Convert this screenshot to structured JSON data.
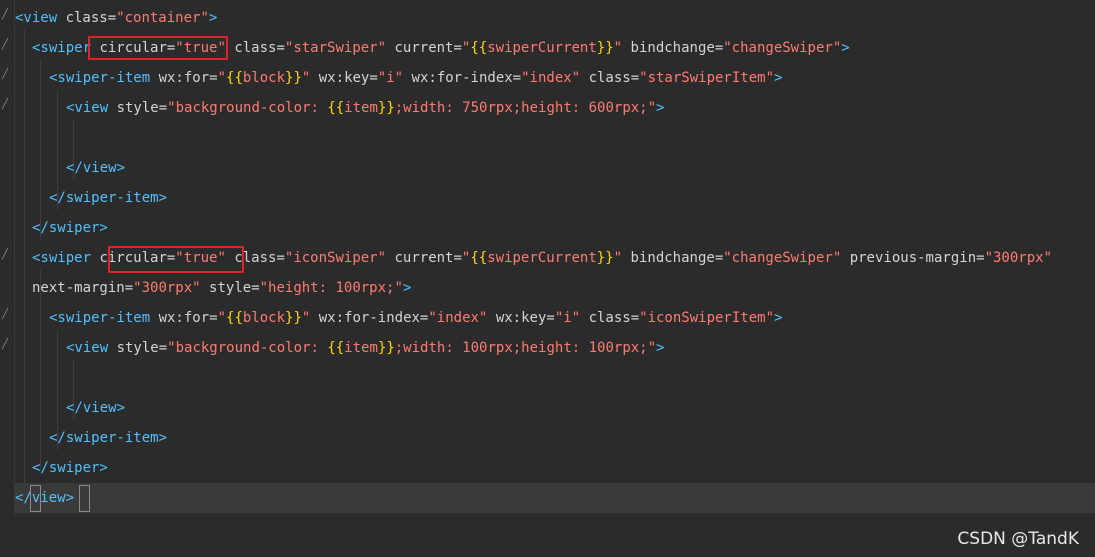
{
  "lines": [
    {
      "indent": 0,
      "tokens": [
        [
          "tag",
          "<view "
        ],
        [
          "attr",
          "class="
        ],
        [
          "str",
          "\"container\""
        ],
        [
          "tag",
          ">"
        ]
      ]
    },
    {
      "indent": 1,
      "tokens": [
        [
          "tag",
          "<swiper "
        ],
        [
          "attr",
          "circular="
        ],
        [
          "str",
          "\"true\""
        ],
        [
          "plain",
          " "
        ],
        [
          "attr",
          "class="
        ],
        [
          "str",
          "\"starSwiper\""
        ],
        [
          "plain",
          " "
        ],
        [
          "attr",
          "current="
        ],
        [
          "str",
          "\""
        ],
        [
          "brace",
          "{{"
        ],
        [
          "str",
          "swiperCurrent"
        ],
        [
          "brace",
          "}}"
        ],
        [
          "str",
          "\""
        ],
        [
          "plain",
          " "
        ],
        [
          "attr",
          "bindchange="
        ],
        [
          "str",
          "\"changeSwiper\""
        ],
        [
          "tag",
          ">"
        ]
      ]
    },
    {
      "indent": 2,
      "tokens": [
        [
          "tag",
          "<swiper-item "
        ],
        [
          "attr",
          "wx:for="
        ],
        [
          "str",
          "\""
        ],
        [
          "brace",
          "{{"
        ],
        [
          "str",
          "block"
        ],
        [
          "brace",
          "}}"
        ],
        [
          "str",
          "\""
        ],
        [
          "plain",
          " "
        ],
        [
          "attr",
          "wx:key="
        ],
        [
          "str",
          "\"i\""
        ],
        [
          "plain",
          " "
        ],
        [
          "attr",
          "wx:for-index="
        ],
        [
          "str",
          "\"index\""
        ],
        [
          "plain",
          " "
        ],
        [
          "attr",
          "class="
        ],
        [
          "str",
          "\"starSwiperItem\""
        ],
        [
          "tag",
          ">"
        ]
      ]
    },
    {
      "indent": 3,
      "tokens": [
        [
          "tag",
          "<view "
        ],
        [
          "attr",
          "style="
        ],
        [
          "str",
          "\"background-color: "
        ],
        [
          "brace",
          "{{"
        ],
        [
          "str",
          "item"
        ],
        [
          "brace",
          "}}"
        ],
        [
          "str",
          ";width: 750rpx;height: 600rpx;\""
        ],
        [
          "tag",
          ">"
        ]
      ]
    },
    {
      "indent": 3,
      "tokens": []
    },
    {
      "indent": 3,
      "tokens": [
        [
          "tag",
          "</view>"
        ]
      ]
    },
    {
      "indent": 2,
      "tokens": [
        [
          "tag",
          "</swiper-item>"
        ]
      ]
    },
    {
      "indent": 1,
      "tokens": [
        [
          "tag",
          "</swiper>"
        ]
      ]
    },
    {
      "indent": 1,
      "tokens": [
        [
          "tag",
          "<swiper "
        ],
        [
          "attr",
          "circular="
        ],
        [
          "str",
          "\"true\""
        ],
        [
          "plain",
          " "
        ],
        [
          "attr",
          "class="
        ],
        [
          "str",
          "\"iconSwiper\""
        ],
        [
          "plain",
          " "
        ],
        [
          "attr",
          "current="
        ],
        [
          "str",
          "\""
        ],
        [
          "brace",
          "{{"
        ],
        [
          "str",
          "swiperCurrent"
        ],
        [
          "brace",
          "}}"
        ],
        [
          "str",
          "\""
        ],
        [
          "plain",
          " "
        ],
        [
          "attr",
          "bindchange="
        ],
        [
          "str",
          "\"changeSwiper\""
        ],
        [
          "plain",
          " "
        ],
        [
          "attr",
          "previous-margin="
        ],
        [
          "str",
          "\"300rpx\""
        ]
      ]
    },
    {
      "indent": 1,
      "tokens": [
        [
          "attr",
          "next-margin="
        ],
        [
          "str",
          "\"300rpx\""
        ],
        [
          "plain",
          " "
        ],
        [
          "attr",
          "style="
        ],
        [
          "str",
          "\"height: 100rpx;\""
        ],
        [
          "tag",
          ">"
        ]
      ]
    },
    {
      "indent": 2,
      "tokens": [
        [
          "tag",
          "<swiper-item "
        ],
        [
          "attr",
          "wx:for="
        ],
        [
          "str",
          "\""
        ],
        [
          "brace",
          "{{"
        ],
        [
          "str",
          "block"
        ],
        [
          "brace",
          "}}"
        ],
        [
          "str",
          "\""
        ],
        [
          "plain",
          " "
        ],
        [
          "attr",
          "wx:for-index="
        ],
        [
          "str",
          "\"index\""
        ],
        [
          "plain",
          " "
        ],
        [
          "attr",
          "wx:key="
        ],
        [
          "str",
          "\"i\""
        ],
        [
          "plain",
          " "
        ],
        [
          "attr",
          "class="
        ],
        [
          "str",
          "\"iconSwiperItem\""
        ],
        [
          "tag",
          ">"
        ]
      ]
    },
    {
      "indent": 3,
      "tokens": [
        [
          "tag",
          "<view "
        ],
        [
          "attr",
          "style="
        ],
        [
          "str",
          "\"background-color: "
        ],
        [
          "brace",
          "{{"
        ],
        [
          "str",
          "item"
        ],
        [
          "brace",
          "}}"
        ],
        [
          "str",
          ";width: 100rpx;height: 100rpx;\""
        ],
        [
          "tag",
          ">"
        ]
      ]
    },
    {
      "indent": 3,
      "tokens": []
    },
    {
      "indent": 3,
      "tokens": [
        [
          "tag",
          "</view>"
        ]
      ]
    },
    {
      "indent": 2,
      "tokens": [
        [
          "tag",
          "</swiper-item>"
        ]
      ]
    },
    {
      "indent": 1,
      "tokens": [
        [
          "tag",
          "</swiper>"
        ]
      ]
    },
    {
      "indent": 0,
      "tokens": [
        [
          "tag",
          "</view>"
        ]
      ],
      "current": true
    }
  ],
  "watermark": "CSDN @TandK",
  "colors": {
    "background": "#2b2b2b",
    "tag": "#4fc1ff",
    "string": "#ff7b72",
    "brace": "#ffd700",
    "highlight_box": "#e0242b"
  }
}
